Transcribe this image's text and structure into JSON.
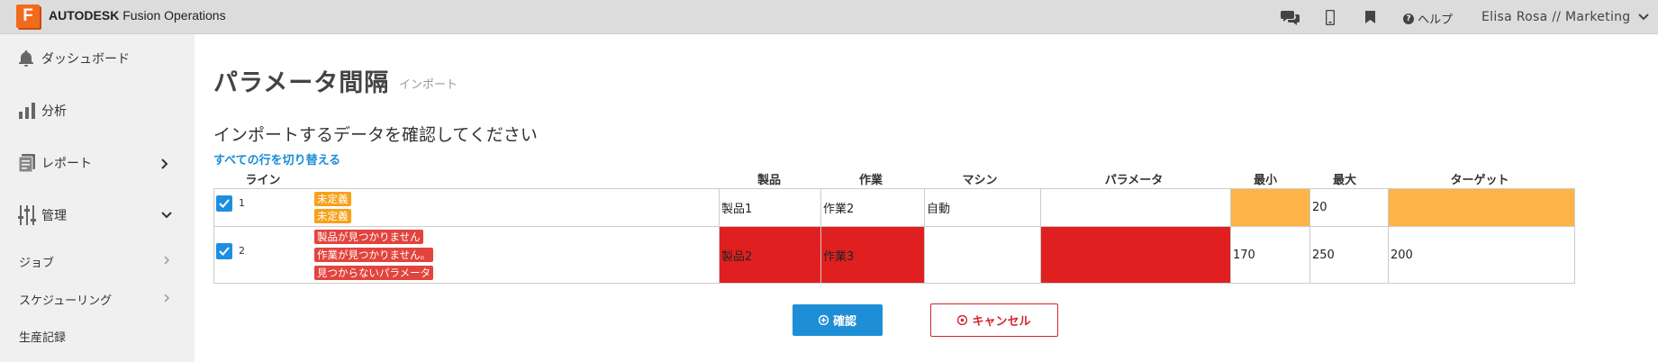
{
  "header": {
    "logo_letter": "F",
    "brand_bold": "AUTODESK",
    "brand_rest": "Fusion Operations",
    "help_label": "ヘルプ",
    "user_label": "Elisa Rosa // Marketing"
  },
  "sidebar": {
    "items": [
      {
        "label": "ダッシュボード",
        "icon": "bell-icon"
      },
      {
        "label": "分析",
        "icon": "bar-chart-icon"
      },
      {
        "label": "レポート",
        "icon": "report-icon"
      },
      {
        "label": "管理",
        "icon": "sliders-icon"
      }
    ],
    "sub_items": [
      {
        "label": "ジョブ"
      },
      {
        "label": "スケジューリング"
      },
      {
        "label": "生産記録"
      }
    ]
  },
  "main": {
    "title": "パラメータ間隔",
    "subtitle": "インポート",
    "section_title": "インポートするデータを確認してください",
    "toggle_all": "すべての行を切り替える"
  },
  "table": {
    "headers": {
      "line": "ライン",
      "product": "製品",
      "operation": "作業",
      "machine": "マシン",
      "parameter": "パラメータ",
      "min": "最小",
      "max": "最大",
      "target": "ターゲット"
    },
    "rows": [
      {
        "line": "1",
        "badges": [
          "未定義",
          "未定義"
        ],
        "product": "製品1",
        "operation": "作業2",
        "machine": "自動",
        "parameter": "",
        "min": "",
        "max": "20",
        "target": ""
      },
      {
        "line": "2",
        "badges": [
          "製品が見つかりません",
          "作業が見つかりません。",
          "見つからないパラメータ"
        ],
        "product": "製品2",
        "operation": "作業3",
        "machine": "",
        "parameter": "",
        "min": "170",
        "max": "250",
        "target": "200"
      }
    ]
  },
  "buttons": {
    "confirm": "確認",
    "cancel": "キャンセル"
  },
  "colors": {
    "accent": "#1e8fd6",
    "error": "#e02020",
    "warning": "#fdb347",
    "brand": "#f26b1d"
  }
}
